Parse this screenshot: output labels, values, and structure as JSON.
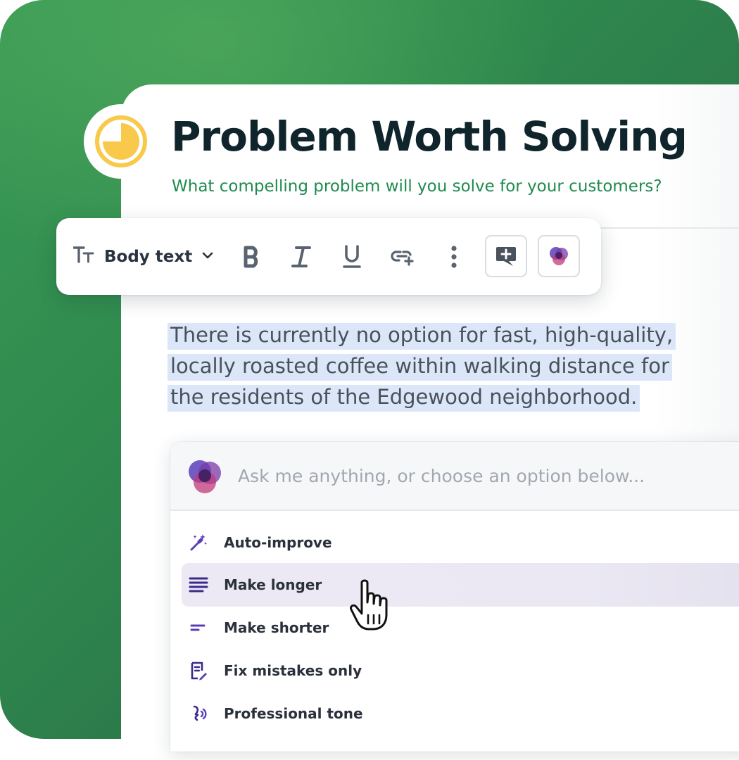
{
  "page": {
    "title": "Problem Worth Solving",
    "subtitle": "What compelling problem will you solve for your customers?",
    "logo_icon": "pie-clock-icon"
  },
  "toolbar": {
    "text_style_icon": "text-size-icon",
    "text_style_label": "Body text",
    "buttons": [
      {
        "name": "bold",
        "icon": "bold-icon"
      },
      {
        "name": "italic",
        "icon": "italic-icon"
      },
      {
        "name": "underline",
        "icon": "underline-icon"
      },
      {
        "name": "link",
        "icon": "link-icon"
      },
      {
        "name": "more",
        "icon": "more-vertical-icon"
      },
      {
        "name": "comment",
        "icon": "comment-plus-icon"
      },
      {
        "name": "ai-assistant",
        "icon": "ai-blob-icon"
      }
    ]
  },
  "body": {
    "paragraph": "There is currently no option for fast, high-quality, locally roasted coffee within  walking distance for the residents of the Edgewood neighborhood."
  },
  "ai_panel": {
    "placeholder": "Ask me anything, or choose an option below...",
    "options": [
      {
        "label": "Auto-improve",
        "icon": "magic-wand-icon",
        "active": false
      },
      {
        "label": "Make longer",
        "icon": "lines-long-icon",
        "active": true
      },
      {
        "label": "Make shorter",
        "icon": "lines-short-icon",
        "active": false
      },
      {
        "label": "Fix mistakes only",
        "icon": "document-edit-icon",
        "active": false
      },
      {
        "label": "Professional tone",
        "icon": "voice-icon",
        "active": false
      }
    ]
  },
  "colors": {
    "background_green": "#2f8a4e",
    "title": "#10242c",
    "subtitle_green": "#1f8a4e",
    "highlight": "#dbe7f8",
    "accent_purple": "#5b3fb8",
    "logo_yellow": "#f8c94a"
  }
}
